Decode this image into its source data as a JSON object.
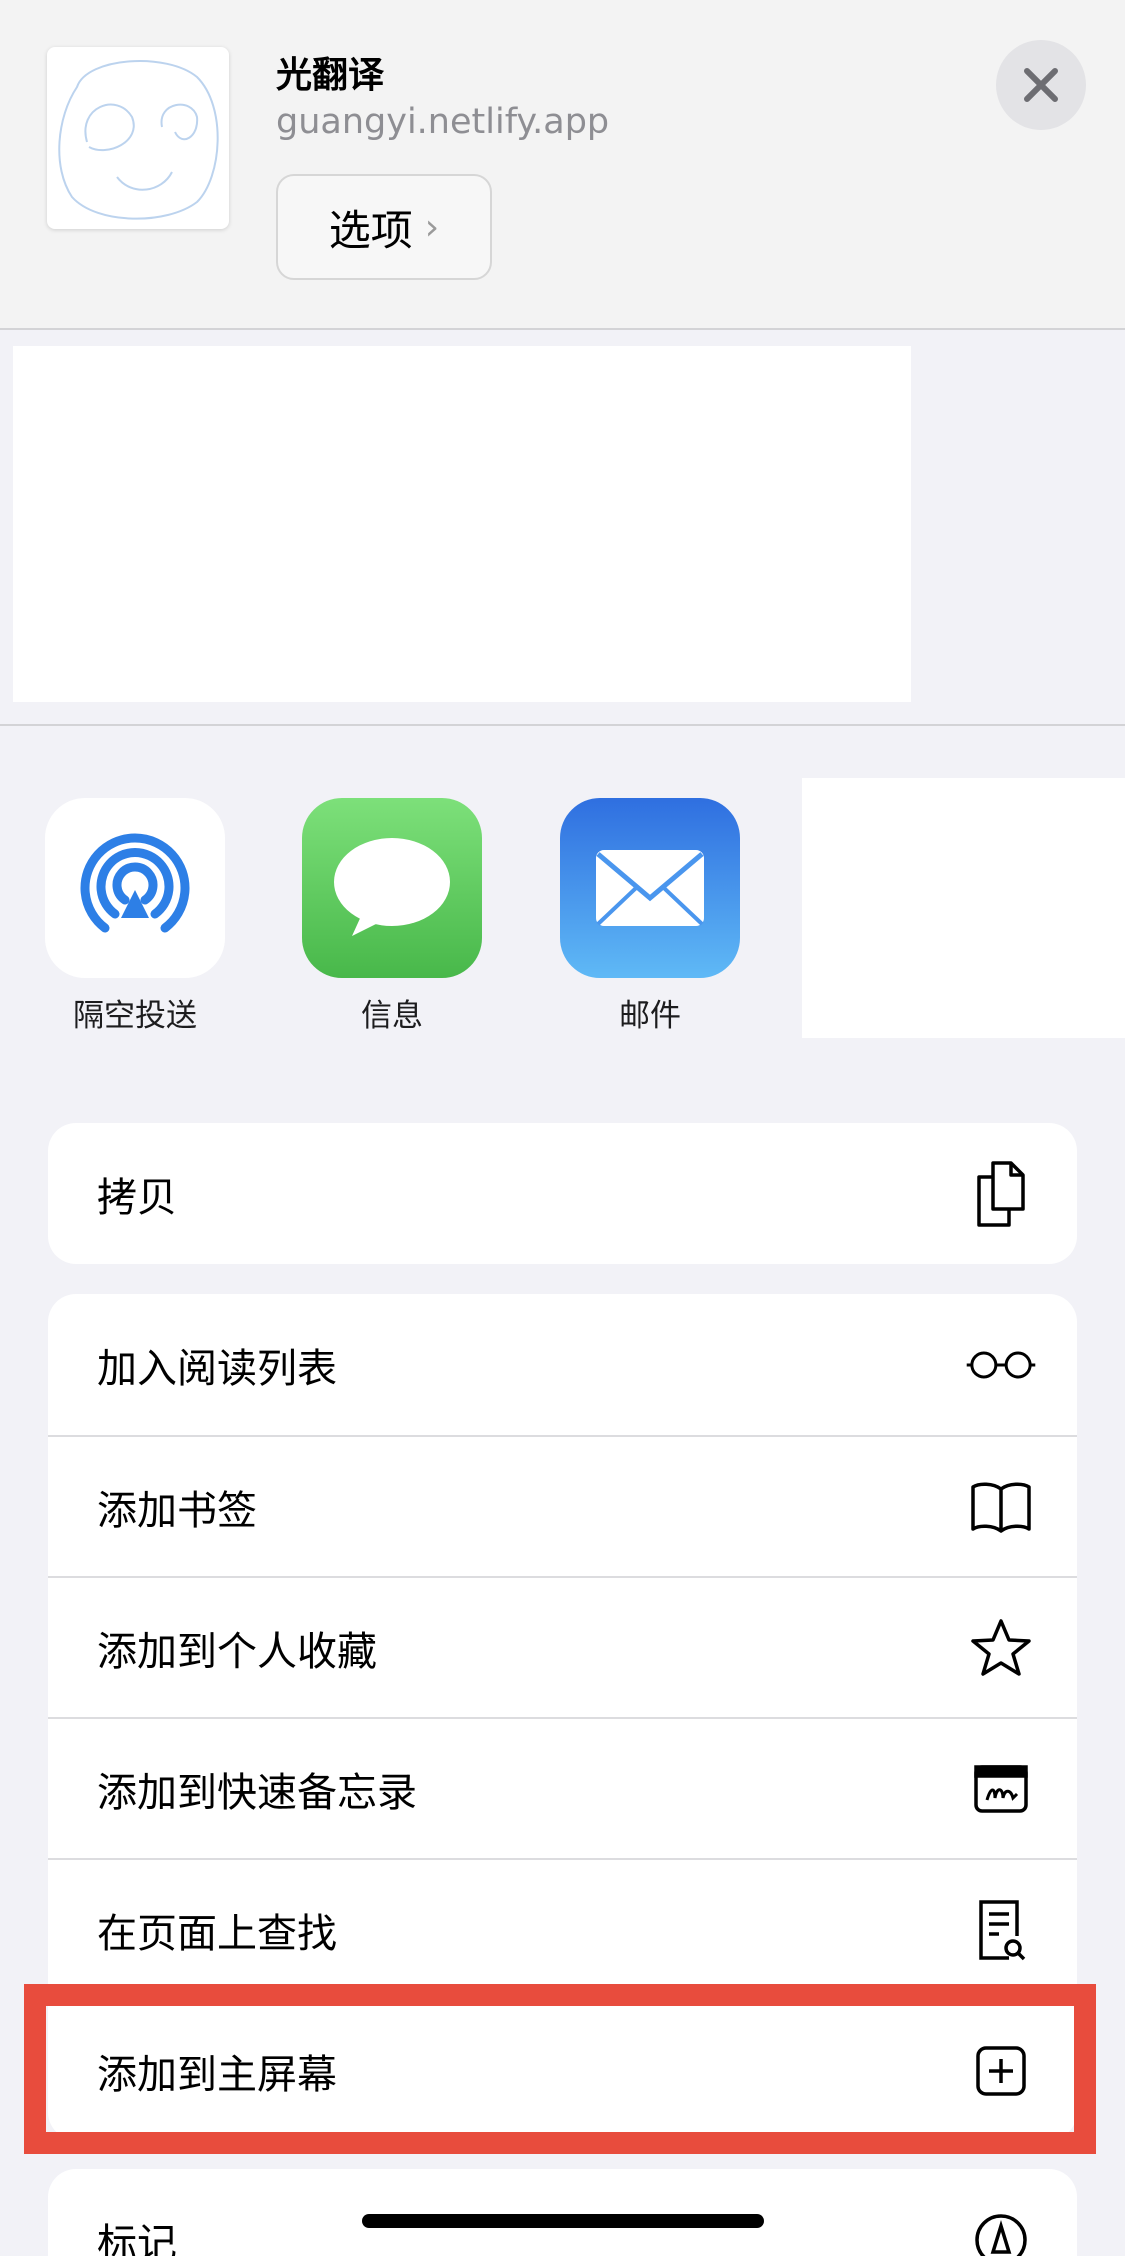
{
  "header": {
    "app_name": "光翻译",
    "url": "guangyi.netlify.app",
    "options_label": "选项",
    "options_chevron": "›"
  },
  "share_targets": [
    {
      "label": "隔空投送",
      "icon": "airdrop-icon"
    },
    {
      "label": "信息",
      "icon": "messages-icon"
    },
    {
      "label": "邮件",
      "icon": "mail-icon"
    }
  ],
  "actions_group1": [
    {
      "label": "拷贝",
      "icon": "copy-icon"
    }
  ],
  "actions_group2": [
    {
      "label": "加入阅读列表",
      "icon": "glasses-icon"
    },
    {
      "label": "添加书签",
      "icon": "book-icon"
    },
    {
      "label": "添加到个人收藏",
      "icon": "star-icon"
    },
    {
      "label": "添加到快速备忘录",
      "icon": "quick-note-icon"
    },
    {
      "label": "在页面上查找",
      "icon": "find-on-page-icon"
    },
    {
      "label": "添加到主屏幕",
      "icon": "add-square-icon"
    }
  ],
  "actions_group3": [
    {
      "label": "标记",
      "icon": "markup-icon"
    }
  ],
  "colors": {
    "highlight": "#e84c3d",
    "airdrop_blue": "#2d7fe6",
    "messages_green": "#5ac85a",
    "mail_blue": "#3a8ff0"
  }
}
